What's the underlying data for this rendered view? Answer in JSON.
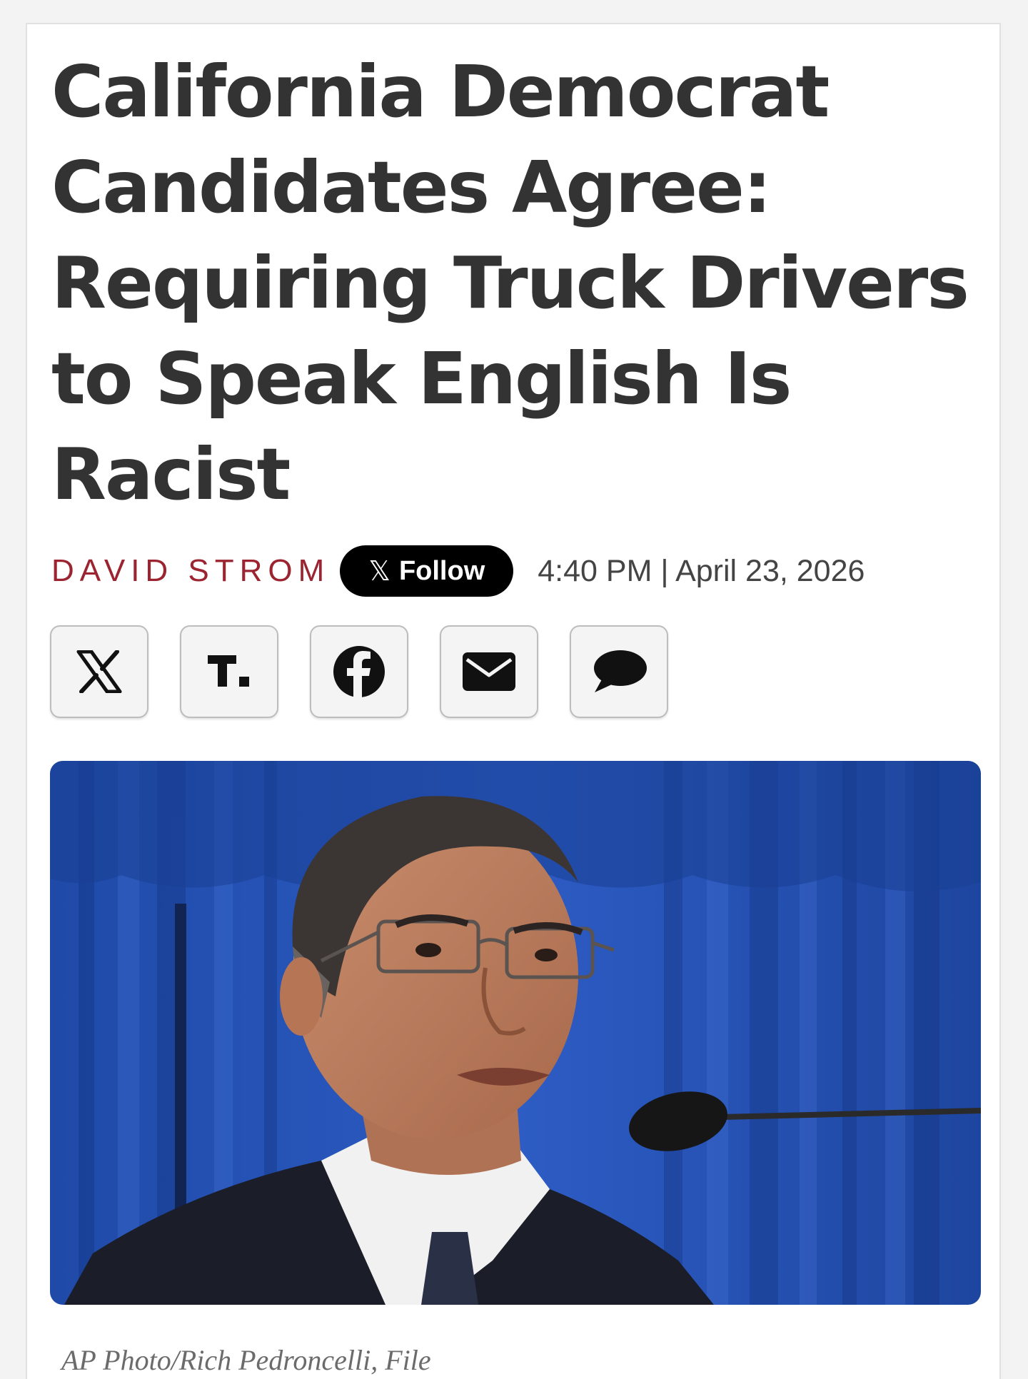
{
  "article": {
    "headline": "California Democrat Candidates Agree: Requiring Truck Drivers to Speak English Is Racist",
    "author": "DAVID STROM",
    "follow_button": {
      "icon": "x-logo-icon",
      "label": "Follow"
    },
    "timestamp": "4:40 PM | April 23, 2026",
    "accent_color": "#9b2430"
  },
  "share_buttons": [
    {
      "icon": "x-logo-icon"
    },
    {
      "icon": "truth-social-icon"
    },
    {
      "icon": "facebook-icon"
    },
    {
      "icon": "email-icon"
    },
    {
      "icon": "comment-icon"
    }
  ],
  "photo": {
    "caption": "AP Photo/Rich Pedroncelli, File"
  }
}
